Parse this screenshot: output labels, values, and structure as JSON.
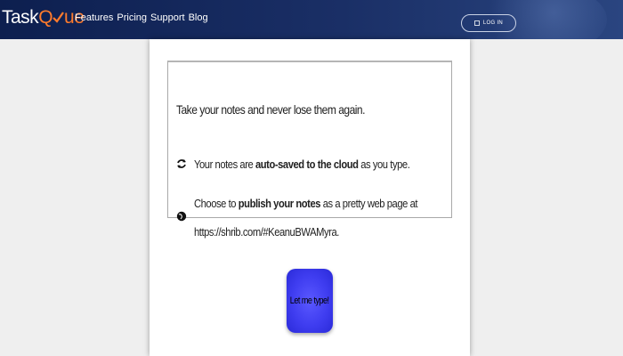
{
  "header": {
    "logo_prefix": "Task",
    "logo_q": "Q",
    "logo_suffix": "ue",
    "nav": [
      "Features",
      "Pricing",
      "Support",
      "Blog"
    ],
    "login_label": "LOG IN"
  },
  "main": {
    "intro": "Take your notes and never lose them again.",
    "features": [
      {
        "icon": "refresh-icon",
        "before": "Your notes are ",
        "bold": "auto-saved to the cloud",
        "after": " as you type."
      },
      {
        "icon": "globe-icon",
        "before": "Choose to ",
        "bold": "publish your notes",
        "after": " as a pretty web page at https://shrib.com/#KeanuBWAMyra."
      }
    ],
    "cta_label": "Let me type!"
  },
  "colors": {
    "header_bg": "#0d1f4f",
    "logo_accent": "#ff7b2c",
    "cta_bg": "#3f3df0",
    "page_bg": "#efefef"
  }
}
